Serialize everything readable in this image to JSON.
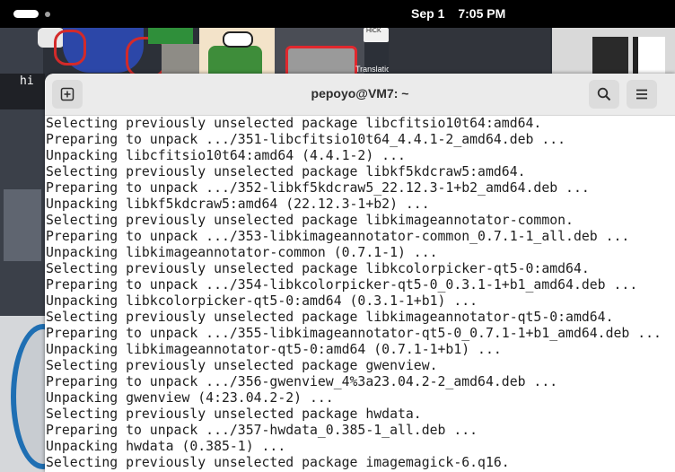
{
  "topbar": {
    "date": "Sep 1",
    "time": "7:05 PM"
  },
  "wallpaper": {
    "sign_text": "HICK",
    "translation_text": "Translation by:",
    "fragment_text": "hi"
  },
  "window": {
    "title": "pepoyo@VM7: ~"
  },
  "terminal": {
    "lines": [
      "Selecting previously unselected package libcfitsio10t64:amd64.",
      "Preparing to unpack .../351-libcfitsio10t64_4.4.1-2_amd64.deb ...",
      "Unpacking libcfitsio10t64:amd64 (4.4.1-2) ...",
      "Selecting previously unselected package libkf5kdcraw5:amd64.",
      "Preparing to unpack .../352-libkf5kdcraw5_22.12.3-1+b2_amd64.deb ...",
      "Unpacking libkf5kdcraw5:amd64 (22.12.3-1+b2) ...",
      "Selecting previously unselected package libkimageannotator-common.",
      "Preparing to unpack .../353-libkimageannotator-common_0.7.1-1_all.deb ...",
      "Unpacking libkimageannotator-common (0.7.1-1) ...",
      "Selecting previously unselected package libkcolorpicker-qt5-0:amd64.",
      "Preparing to unpack .../354-libkcolorpicker-qt5-0_0.3.1-1+b1_amd64.deb ...",
      "Unpacking libkcolorpicker-qt5-0:amd64 (0.3.1-1+b1) ...",
      "Selecting previously unselected package libkimageannotator-qt5-0:amd64.",
      "Preparing to unpack .../355-libkimageannotator-qt5-0_0.7.1-1+b1_amd64.deb ...",
      "Unpacking libkimageannotator-qt5-0:amd64 (0.7.1-1+b1) ...",
      "Selecting previously unselected package gwenview.",
      "Preparing to unpack .../356-gwenview_4%3a23.04.2-2_amd64.deb ...",
      "Unpacking gwenview (4:23.04.2-2) ...",
      "Selecting previously unselected package hwdata.",
      "Preparing to unpack .../357-hwdata_0.385-1_all.deb ...",
      "Unpacking hwdata (0.385-1) ...",
      "Selecting previously unselected package imagemagick-6.q16."
    ]
  }
}
